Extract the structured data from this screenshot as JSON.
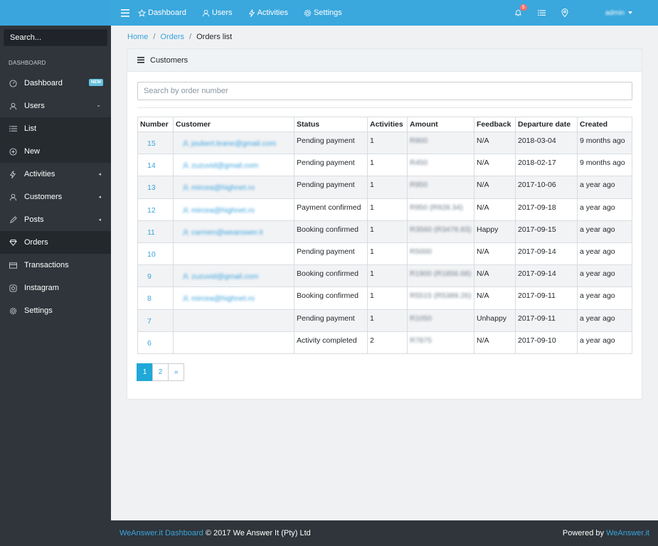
{
  "header": {
    "nav": [
      {
        "label": "Dashboard",
        "icon": "star-icon"
      },
      {
        "label": "Users",
        "icon": "user-icon"
      },
      {
        "label": "Activities",
        "icon": "bolt-icon"
      },
      {
        "label": "Settings",
        "icon": "gear-icon"
      }
    ],
    "notifications_count": "5",
    "user": "admin"
  },
  "sidebar": {
    "search_placeholder": "Search...",
    "section_title": "DASHBOARD",
    "items": [
      {
        "label": "Dashboard",
        "icon": "speedometer-icon",
        "badge": "NEW"
      },
      {
        "label": "Users",
        "icon": "user-icon"
      },
      {
        "label": "List",
        "icon": "list-icon"
      },
      {
        "label": "New",
        "icon": "plus-circle-icon"
      },
      {
        "label": "Activities",
        "icon": "bolt-icon"
      },
      {
        "label": "Customers",
        "icon": "users-icon"
      },
      {
        "label": "Posts",
        "icon": "pencil-icon"
      },
      {
        "label": "Orders",
        "icon": "diamond-icon"
      },
      {
        "label": "Transactions",
        "icon": "credit-card-icon"
      },
      {
        "label": "Instagram",
        "icon": "instagram-icon"
      },
      {
        "label": "Settings",
        "icon": "gear-icon"
      }
    ]
  },
  "breadcrumb": {
    "home": "Home",
    "orders": "Orders",
    "current": "Orders list"
  },
  "card": {
    "title": "Customers",
    "search_placeholder": "Search by order number"
  },
  "table": {
    "columns": [
      "Number",
      "Customer",
      "Status",
      "Activities",
      "Amount",
      "Feedback",
      "Departure date",
      "Created"
    ],
    "rows": [
      {
        "number": "15",
        "customer": "joubert.leane@gmail.com",
        "status": "Pending payment",
        "activities": "1",
        "amount": "R900",
        "feedback": "N/A",
        "departure": "2018-03-04",
        "created": "9 months ago"
      },
      {
        "number": "14",
        "customer": "zuzuvid@gmail.com",
        "status": "Pending payment",
        "activities": "1",
        "amount": "R450",
        "feedback": "N/A",
        "departure": "2018-02-17",
        "created": "9 months ago"
      },
      {
        "number": "13",
        "customer": "mircea@highnet.ro",
        "status": "Pending payment",
        "activities": "1",
        "amount": "R950",
        "feedback": "N/A",
        "departure": "2017-10-06",
        "created": "a year ago"
      },
      {
        "number": "12",
        "customer": "mircea@highnet.ro",
        "status": "Payment confirmed",
        "activities": "1",
        "amount": "R950 (R928.34)",
        "feedback": "N/A",
        "departure": "2017-09-18",
        "created": "a year ago"
      },
      {
        "number": "11",
        "customer": "carmen@weanswer.it",
        "status": "Booking confirmed",
        "activities": "1",
        "amount": "R3560 (R3478.83)",
        "feedback": "Happy",
        "departure": "2017-09-15",
        "created": "a year ago"
      },
      {
        "number": "10",
        "customer": "",
        "status": "Pending payment",
        "activities": "1",
        "amount": "R5000",
        "feedback": "N/A",
        "departure": "2017-09-14",
        "created": "a year ago"
      },
      {
        "number": "9",
        "customer": "zuzuvid@gmail.com",
        "status": "Booking confirmed",
        "activities": "1",
        "amount": "R1900 (R1856.68)",
        "feedback": "N/A",
        "departure": "2017-09-14",
        "created": "a year ago"
      },
      {
        "number": "8",
        "customer": "mircea@highnet.ro",
        "status": "Booking confirmed",
        "activities": "1",
        "amount": "R5515 (R5389.26)",
        "feedback": "N/A",
        "departure": "2017-09-11",
        "created": "a year ago"
      },
      {
        "number": "7",
        "customer": "",
        "status": "Pending payment",
        "activities": "1",
        "amount": "R1050",
        "feedback": "Unhappy",
        "departure": "2017-09-11",
        "created": "a year ago"
      },
      {
        "number": "6",
        "customer": "",
        "status": "Activity completed",
        "activities": "2",
        "amount": "R7875",
        "feedback": "N/A",
        "departure": "2017-09-10",
        "created": "a year ago"
      }
    ]
  },
  "pagination": {
    "pages": [
      "1",
      "2"
    ],
    "next": "»",
    "current": "1"
  },
  "footer": {
    "left_link": "WeAnswer.it Dashboard",
    "left_text": "© 2017 We Answer It (Pty) Ltd",
    "right_text": "Powered by",
    "right_link": "WeAnswer.it"
  },
  "colors": {
    "primary": "#3aa7dd",
    "sidebar": "#2f353a",
    "badge": "#63c2de",
    "alert": "#f86c6b"
  }
}
